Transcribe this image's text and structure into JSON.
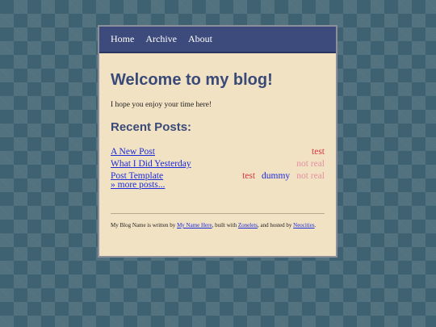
{
  "nav": {
    "items": [
      "Home",
      "Archive",
      "About"
    ]
  },
  "main": {
    "title": "Welcome to my blog!",
    "intro": "I hope you enjoy your time here!",
    "recent_heading": "Recent Posts:",
    "posts": [
      {
        "title": "A New Post",
        "tags": [
          "test"
        ]
      },
      {
        "title": "What I Did Yesterday",
        "tags": [
          "not real"
        ]
      },
      {
        "title": "Post Template",
        "tags": [
          "test",
          "dummy",
          "not real"
        ]
      }
    ],
    "more_link": "» more posts..."
  },
  "footer": {
    "prefix": "My Blog Name is written by ",
    "author_link": "My Name Here",
    "middle": ", built with ",
    "engine_link": "Zonelets",
    "middle2": ", and hosted by ",
    "host_link": "Neocities",
    "suffix": "."
  },
  "colors": {
    "background": "#3f6272",
    "nav_bg": "#3c4a7c",
    "panel_bg": "#f2e2c4",
    "heading": "#3a4a78",
    "link": "#1a2ad8",
    "tag_test": "#d8333d",
    "tag_dummy": "#1a2ad8",
    "tag_not_real": "#e58fa0"
  }
}
